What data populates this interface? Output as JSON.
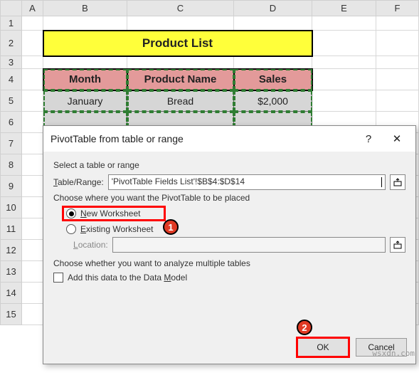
{
  "columns": [
    "A",
    "B",
    "C",
    "D",
    "E",
    "F"
  ],
  "rows": [
    "1",
    "2",
    "3",
    "4",
    "5",
    "6",
    "7",
    "8",
    "9",
    "10",
    "11",
    "12",
    "13",
    "14",
    "15"
  ],
  "title_cell": "Product List",
  "table": {
    "headers": {
      "b": "Month",
      "c": "Product Name",
      "d": "Sales"
    },
    "row1": {
      "b": "January",
      "c": "Bread",
      "d": "$2,000"
    }
  },
  "dialog": {
    "title": "PivotTable from table or range",
    "help": "?",
    "close": "✕",
    "sec1": "Select a table or range",
    "table_label_pre": "T",
    "table_label_mid": "able/Range:",
    "table_value": "'PivotTable Fields List'!$B$4:$D$14",
    "sec2": "Choose where you want the PivotTable to be placed",
    "opt_new_pre": "N",
    "opt_new_post": "ew Worksheet",
    "opt_existing_pre": "E",
    "opt_existing_post": "xisting Worksheet",
    "loc_label_pre": "L",
    "loc_label_post": "ocation:",
    "sec3": "Choose whether you want to analyze multiple tables",
    "chk_label_pre": "Add this data to the Data ",
    "chk_label_u": "M",
    "chk_label_post": "odel",
    "ok": "OK",
    "cancel": "Cancel"
  },
  "ann": {
    "one": "1",
    "two": "2"
  },
  "watermark": "wsxdn.com"
}
